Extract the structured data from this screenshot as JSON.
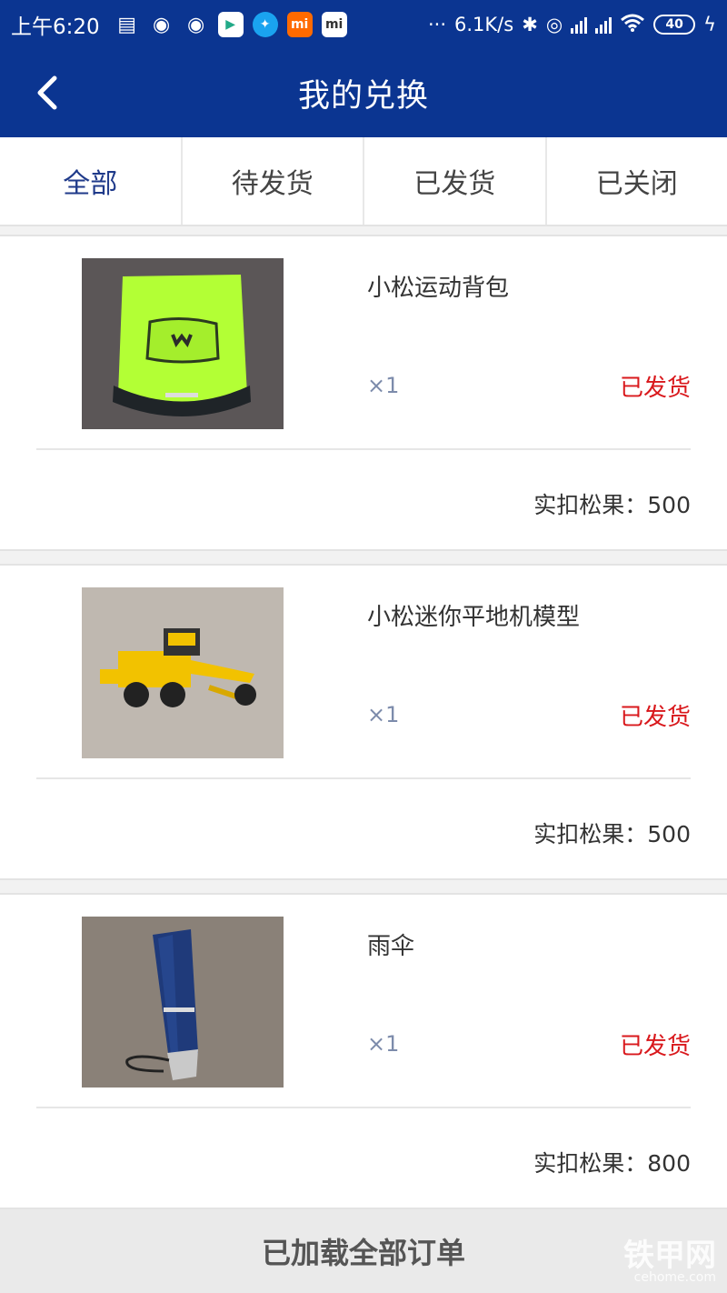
{
  "status_bar": {
    "time": "上午6:20",
    "net_speed": "6.1K/s",
    "battery": "40"
  },
  "header": {
    "title": "我的兑换"
  },
  "tabs": [
    {
      "label": "全部"
    },
    {
      "label": "待发货"
    },
    {
      "label": "已发货"
    },
    {
      "label": "已关闭"
    }
  ],
  "orders": [
    {
      "name": "小松运动背包",
      "qty": "×1",
      "status": "已发货",
      "cost": "实扣松果：500"
    },
    {
      "name": "小松迷你平地机模型",
      "qty": "×1",
      "status": "已发货",
      "cost": "实扣松果：500"
    },
    {
      "name": "雨伞",
      "qty": "×1",
      "status": "已发货",
      "cost": "实扣松果：800"
    }
  ],
  "footer": {
    "text": "已加载全部订单"
  },
  "watermark": {
    "main": "铁甲网",
    "sub": "cehome.com"
  },
  "colors": {
    "primary": "#0b3591",
    "status_red": "#d9181c",
    "tab_active": "#1f3a8a"
  }
}
